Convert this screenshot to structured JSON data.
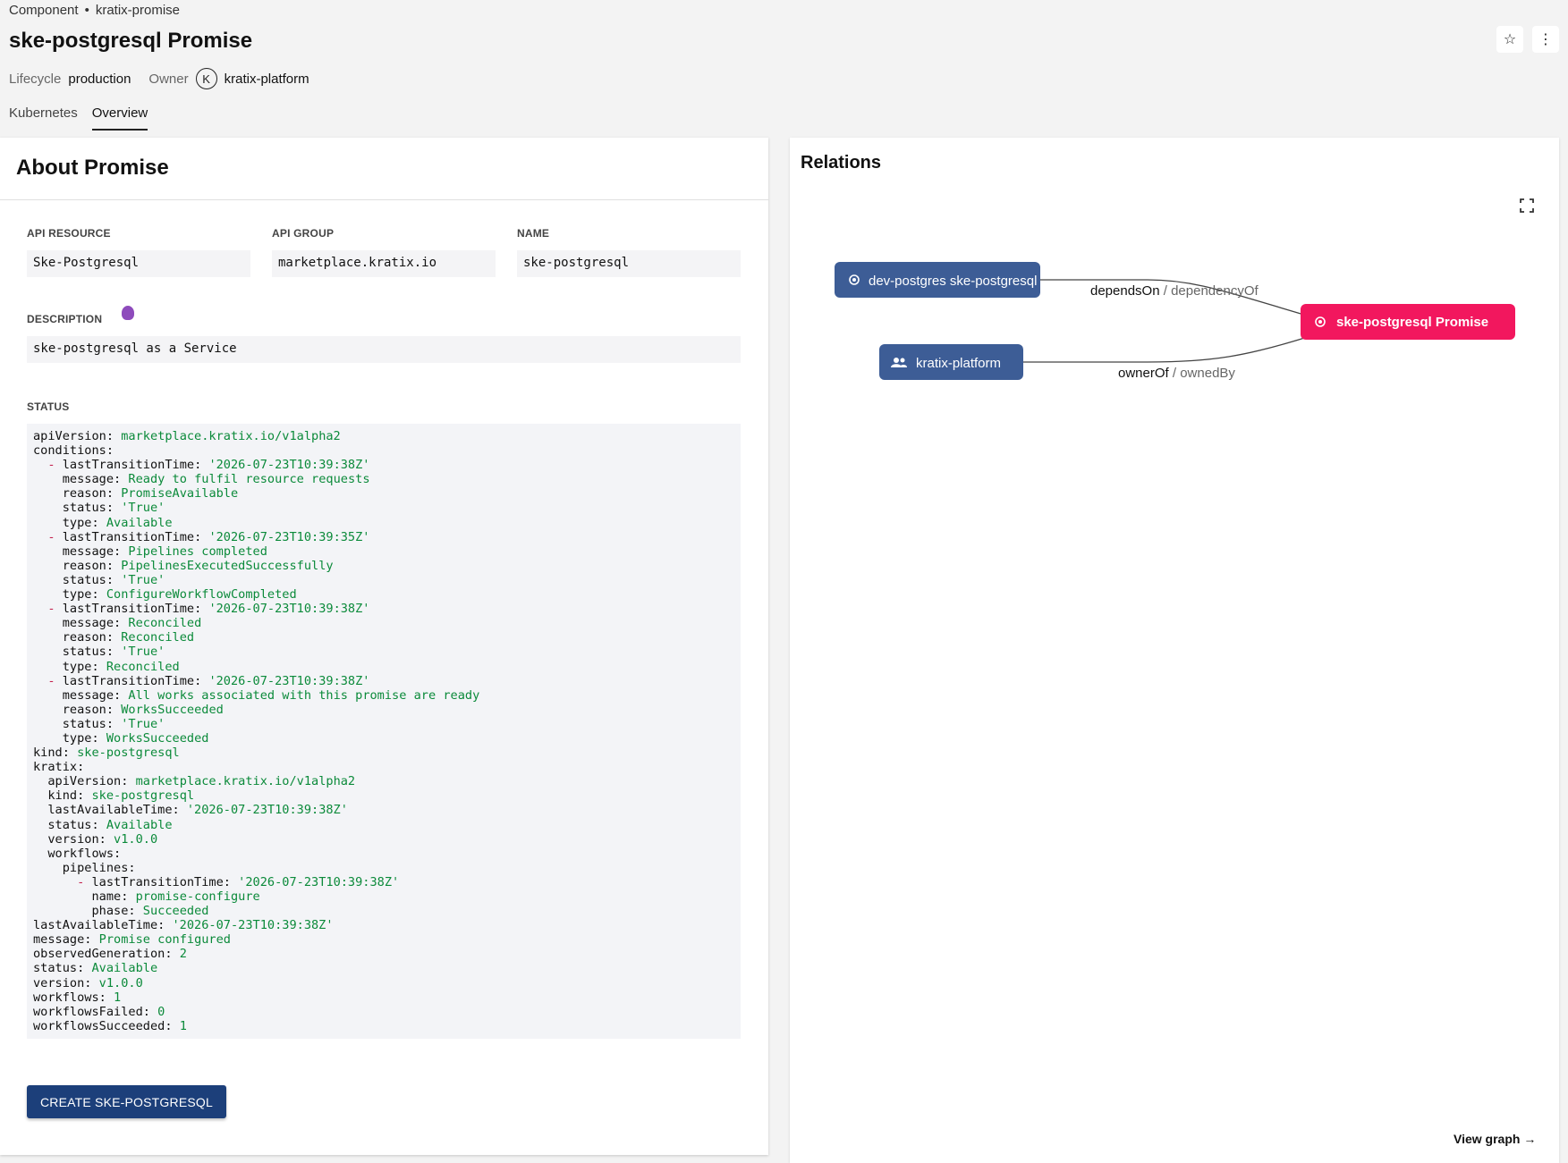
{
  "header": {
    "breadcrumb": {
      "kind": "Component",
      "separator": "•",
      "name": "kratix-promise"
    },
    "title": "ske-postgresql Promise",
    "lifecycle_label": "Lifecycle",
    "lifecycle_value": "production",
    "owner_label": "Owner",
    "owner_avatar": "K",
    "owner_value": "kratix-platform",
    "star_icon": "☆",
    "more_icon": "⋮"
  },
  "tabs": [
    {
      "label": "Kubernetes",
      "active": false
    },
    {
      "label": "Overview",
      "active": true
    }
  ],
  "about": {
    "title": "About Promise",
    "api_resource_label": "API RESOURCE",
    "api_resource_value": "Ske-Postgresql",
    "api_group_label": "API GROUP",
    "api_group_value": "marketplace.kratix.io",
    "name_label": "NAME",
    "name_value": "ske-postgresql",
    "description_label": "DESCRIPTION",
    "description_value": "ske-postgresql as a Service",
    "status_label": "STATUS",
    "status_lines": [
      [
        "",
        "apiVersion: ",
        "marketplace.kratix.io/v1alpha2"
      ],
      [
        "",
        "conditions:",
        ""
      ],
      [
        "  - ",
        "lastTransitionTime: ",
        "'2026-07-23T10:39:38Z'"
      ],
      [
        "    ",
        "message: ",
        "Ready to fulfil resource requests"
      ],
      [
        "    ",
        "reason: ",
        "PromiseAvailable"
      ],
      [
        "    ",
        "status: ",
        "'True'"
      ],
      [
        "    ",
        "type: ",
        "Available"
      ],
      [
        "  - ",
        "lastTransitionTime: ",
        "'2026-07-23T10:39:35Z'"
      ],
      [
        "    ",
        "message: ",
        "Pipelines completed"
      ],
      [
        "    ",
        "reason: ",
        "PipelinesExecutedSuccessfully"
      ],
      [
        "    ",
        "status: ",
        "'True'"
      ],
      [
        "    ",
        "type: ",
        "ConfigureWorkflowCompleted"
      ],
      [
        "  - ",
        "lastTransitionTime: ",
        "'2026-07-23T10:39:38Z'"
      ],
      [
        "    ",
        "message: ",
        "Reconciled"
      ],
      [
        "    ",
        "reason: ",
        "Reconciled"
      ],
      [
        "    ",
        "status: ",
        "'True'"
      ],
      [
        "    ",
        "type: ",
        "Reconciled"
      ],
      [
        "  - ",
        "lastTransitionTime: ",
        "'2026-07-23T10:39:38Z'"
      ],
      [
        "    ",
        "message: ",
        "All works associated with this promise are ready"
      ],
      [
        "    ",
        "reason: ",
        "WorksSucceeded"
      ],
      [
        "    ",
        "status: ",
        "'True'"
      ],
      [
        "    ",
        "type: ",
        "WorksSucceeded"
      ],
      [
        "",
        "kind: ",
        "ske-postgresql"
      ],
      [
        "",
        "kratix:",
        ""
      ],
      [
        "  ",
        "apiVersion: ",
        "marketplace.kratix.io/v1alpha2"
      ],
      [
        "  ",
        "kind: ",
        "ske-postgresql"
      ],
      [
        "  ",
        "lastAvailableTime: ",
        "'2026-07-23T10:39:38Z'"
      ],
      [
        "  ",
        "status: ",
        "Available"
      ],
      [
        "  ",
        "version: ",
        "v1.0.0"
      ],
      [
        "  ",
        "workflows:",
        ""
      ],
      [
        "    ",
        "pipelines:",
        ""
      ],
      [
        "      - ",
        "lastTransitionTime: ",
        "'2026-07-23T10:39:38Z'"
      ],
      [
        "        ",
        "name: ",
        "promise-configure"
      ],
      [
        "        ",
        "phase: ",
        "Succeeded"
      ],
      [
        "",
        "lastAvailableTime: ",
        "'2026-07-23T10:39:38Z'"
      ],
      [
        "",
        "message: ",
        "Promise configured"
      ],
      [
        "",
        "observedGeneration: ",
        "2"
      ],
      [
        "",
        "status: ",
        "Available"
      ],
      [
        "",
        "version: ",
        "v1.0.0"
      ],
      [
        "",
        "workflows: ",
        "1"
      ],
      [
        "",
        "workflowsFailed: ",
        "0"
      ],
      [
        "",
        "workflowsSucceeded: ",
        "1"
      ]
    ],
    "create_button": "CREATE SKE-POSTGRESQL"
  },
  "relations": {
    "title": "Relations",
    "nodes": {
      "dev_postgres": "dev-postgres ske-postgresql",
      "kratix_platform": "kratix-platform",
      "promise": "ske-postgresql Promise"
    },
    "edges": {
      "depends_on": "dependsOn",
      "dependency_of": " / dependencyOf",
      "owner_of": "ownerOf",
      "owned_by": " / ownedBy"
    },
    "view_graph": "View graph",
    "view_graph_arrow": "→",
    "colors": {
      "node": "#3d5d96",
      "focus": "#f2175e"
    }
  }
}
